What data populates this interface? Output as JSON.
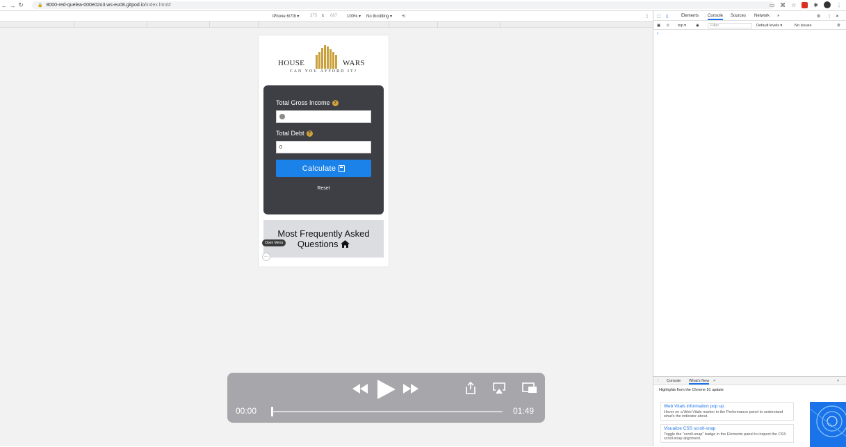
{
  "browser": {
    "url_host": "8000-red-quelea-000e02o3.ws-eu08.gitpod.io",
    "url_path": "/index.html#"
  },
  "device_toolbar": {
    "device": "iPhone 6/7/8 ▾",
    "width": "375",
    "times": "x",
    "height": "667",
    "zoom": "100% ▾",
    "throttle": "No throttling ▾"
  },
  "app": {
    "logo_left": "HOUSE",
    "logo_right": "WARS",
    "tagline": "CAN YOU AFFORD IT?",
    "income_label": "Total Gross Income",
    "help_glyph": "?",
    "debt_label": "Total Debt",
    "debt_value": "0",
    "calculate_label": "Calculate",
    "reset_label": "Reset",
    "faq_line1": "Most Frequently Asked",
    "faq_line2": "Questions",
    "open_menu": "Open Menu",
    "more_glyph": "···"
  },
  "player": {
    "current_time": "00:00",
    "duration": "01:49",
    "progress": 0.0
  },
  "devtools": {
    "tabs": [
      "Elements",
      "Console",
      "Sources",
      "Network"
    ],
    "active_tab": "Console",
    "more": "»",
    "context": "top ▾",
    "filter_placeholder": "Filter",
    "levels": "Default levels ▾",
    "issues": "No Issues",
    "prompt": "›",
    "drawer_tabs": [
      "Console",
      "What's New"
    ],
    "drawer_close": "×",
    "highlights": "Highlights from the Chrome 91 update",
    "news": [
      {
        "title": "Web Vitals information pop up",
        "desc": "Hover on a Web Vitals marker in the Performance panel to understand what's the indicator about."
      },
      {
        "title": "Visualize CSS scroll-snap",
        "desc": "Toggle the \"scroll-snap\" badge in the Elements panel to inspect the CSS scroll-snap alignment."
      }
    ]
  },
  "colors": {
    "card_bg": "#3e3f45",
    "accent_blue": "#1a82e8",
    "logo_gold": "#c9a03c",
    "help_gold": "#d4a23a"
  }
}
